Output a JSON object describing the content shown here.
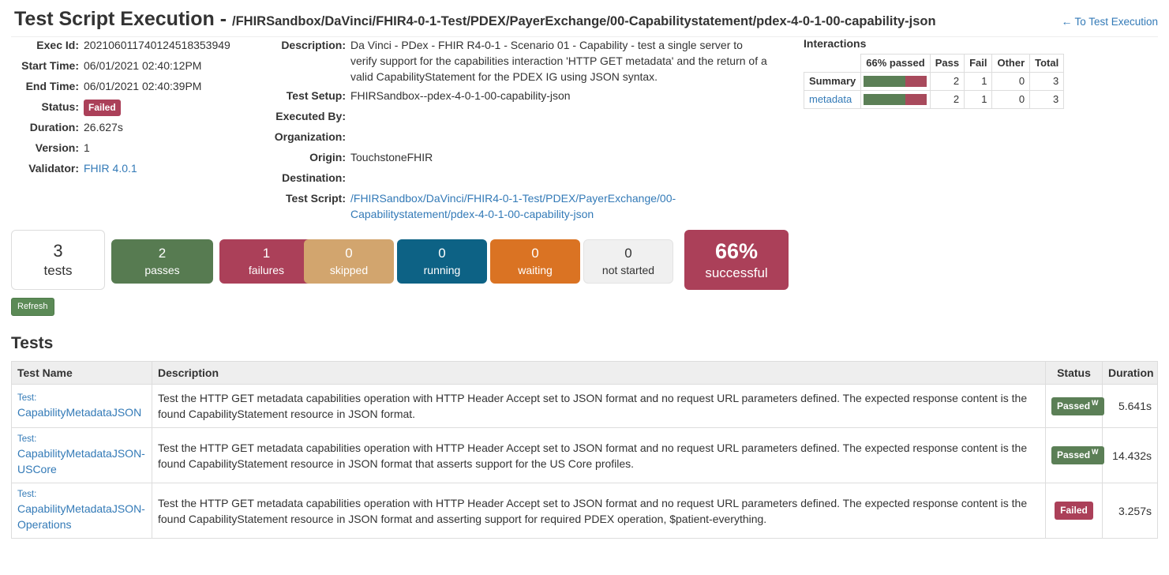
{
  "header": {
    "title": "Test Script Execution",
    "separator": " - ",
    "path": "/FHIRSandbox/DaVinci/FHIR4-0-1-Test/PDEX/PayerExchange/00-Capabilitystatement/pdex-4-0-1-00-capability-json",
    "back_link": "To Test Execution",
    "back_arrow": "←"
  },
  "details_left": {
    "exec_id_label": "Exec Id:",
    "exec_id": "202106011740124518353949",
    "start_time_label": "Start Time:",
    "start_time": "06/01/2021 02:40:12PM",
    "end_time_label": "End Time:",
    "end_time": "06/01/2021 02:40:39PM",
    "status_label": "Status:",
    "status": "Failed",
    "duration_label": "Duration:",
    "duration": "26.627s",
    "version_label": "Version:",
    "version": "1",
    "validator_label": "Validator:",
    "validator": "FHIR 4.0.1"
  },
  "details_mid": {
    "description_label": "Description:",
    "description": "Da Vinci - PDex - FHIR R4-0-1 - Scenario 01 - Capability - test a single server to verify support for the capabilities interaction 'HTTP GET metadata' and the return of a valid CapabilityStatement for the PDEX IG using JSON syntax.",
    "test_setup_label": "Test Setup:",
    "test_setup": "FHIRSandbox--pdex-4-0-1-00-capability-json",
    "executed_by_label": "Executed By:",
    "executed_by": "",
    "organization_label": "Organization:",
    "organization": "",
    "origin_label": "Origin:",
    "origin": "TouchstoneFHIR",
    "destination_label": "Destination:",
    "destination": "",
    "test_script_label": "Test Script:",
    "test_script": "/FHIRSandbox/DaVinci/FHIR4-0-1-Test/PDEX/PayerExchange/00-Capabilitystatement/pdex-4-0-1-00-capability-json"
  },
  "interactions": {
    "heading": "Interactions",
    "columns": [
      "",
      "66% passed",
      "Pass",
      "Fail",
      "Other",
      "Total"
    ],
    "rows": [
      {
        "name": "Summary",
        "is_link": false,
        "pass": "2",
        "fail": "1",
        "other": "0",
        "total": "3",
        "passed_pct": 66
      },
      {
        "name": "metadata",
        "is_link": true,
        "pass": "2",
        "fail": "1",
        "other": "0",
        "total": "3",
        "passed_pct": 66
      }
    ]
  },
  "stats": [
    {
      "num": "3",
      "cap": "tests",
      "key": "tests"
    },
    {
      "num": "2",
      "cap": "passes",
      "key": "passes"
    },
    {
      "num": "1",
      "cap": "failures",
      "key": "failures"
    },
    {
      "num": "0",
      "cap": "skipped",
      "key": "skipped"
    },
    {
      "num": "0",
      "cap": "running",
      "key": "running"
    },
    {
      "num": "0",
      "cap": "waiting",
      "key": "waiting"
    },
    {
      "num": "0",
      "cap": "not started",
      "key": "notstarted"
    },
    {
      "num": "66%",
      "cap": "successful",
      "key": "successful"
    }
  ],
  "refresh_label": "Refresh",
  "tests_heading": "Tests",
  "tests_table": {
    "columns": [
      "Test Name",
      "Description",
      "Status",
      "Duration"
    ],
    "rows": [
      {
        "prefix": "Test:",
        "name": "CapabilityMetadataJSON",
        "description": "Test the HTTP GET metadata capabilities operation with HTTP Header Accept set to JSON format and no request URL parameters defined. The expected response content is the found CapabilityStatement resource in JSON format.",
        "status": "Passed",
        "status_sup": "W",
        "status_kind": "passed",
        "duration": "5.641s"
      },
      {
        "prefix": "Test:",
        "name": "CapabilityMetadataJSON-USCore",
        "description": "Test the HTTP GET metadata capabilities operation with HTTP Header Accept set to JSON format and no request URL parameters defined. The expected response content is the found CapabilityStatement resource in JSON format that asserts support for the US Core profiles.",
        "status": "Passed",
        "status_sup": "W",
        "status_kind": "passed",
        "duration": "14.432s"
      },
      {
        "prefix": "Test:",
        "name": "CapabilityMetadataJSON-Operations",
        "description": "Test the HTTP GET metadata capabilities operation with HTTP Header Accept set to JSON format and no request URL parameters defined. The expected response content is the found CapabilityStatement resource in JSON format and asserting support for required PDEX operation, $patient-everything.",
        "status": "Failed",
        "status_sup": "",
        "status_kind": "failed",
        "duration": "3.257s"
      }
    ]
  },
  "colors": {
    "link": "#337ab7",
    "pass_green": "#5b7f56",
    "fail_red": "#ab4059",
    "skipped_tan": "#d2a56e",
    "running_blue": "#0d6285",
    "waiting_orange": "#da7323",
    "notstarted_grey": "#f0f0f0"
  }
}
